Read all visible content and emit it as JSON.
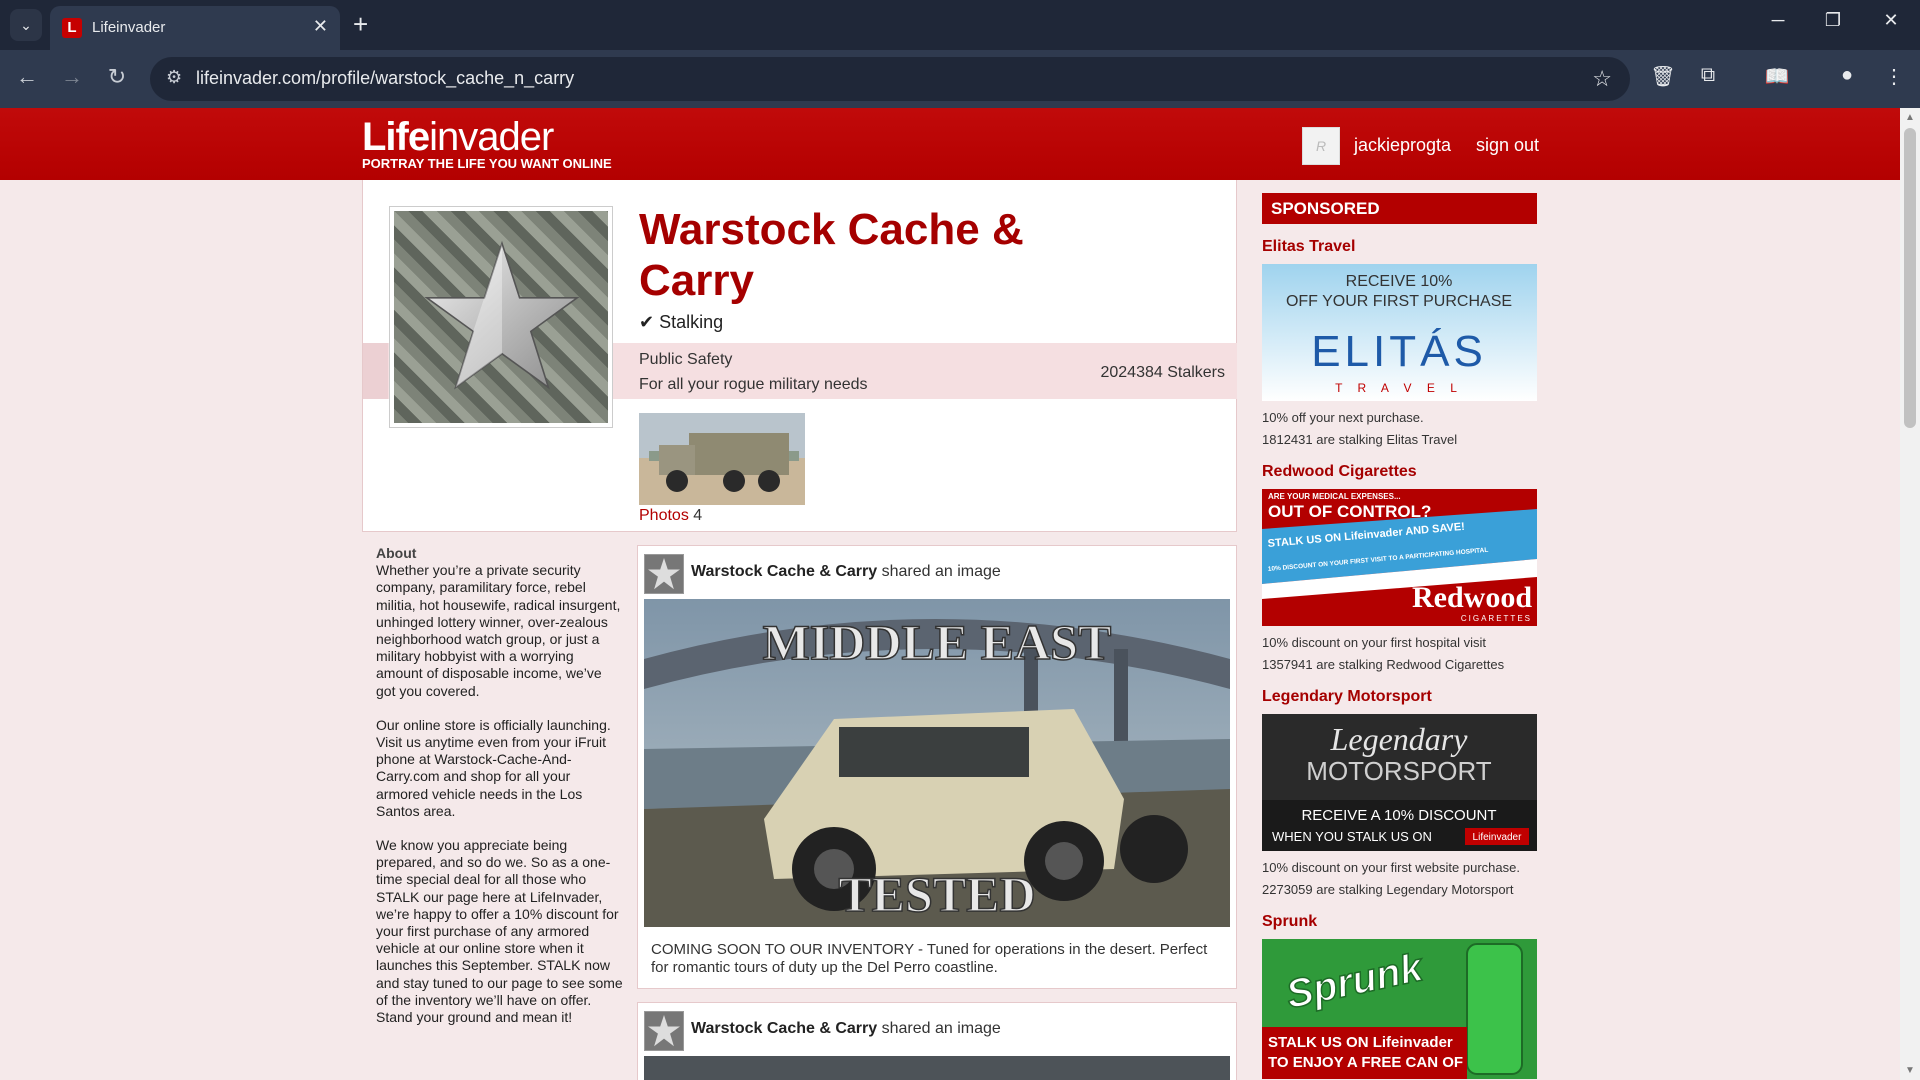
{
  "browser": {
    "tab_title": "Lifeinvader",
    "tab_favicon": "L",
    "url": "lifeinvader.com/profile/warstock_cache_n_carry"
  },
  "site": {
    "logo_bold": "Life",
    "logo_light": "invader",
    "logo_tagline": "PORTRAY THE LIFE YOU WANT ONLINE",
    "username": "jackieprogta",
    "signout": "sign out"
  },
  "profile": {
    "name": "Warstock Cache & Carry",
    "stalking_label": "Stalking",
    "category": "Public Safety",
    "tagline": "For all your rogue military needs",
    "stalkers": "2024384 Stalkers",
    "photos_label": "Photos",
    "photos_count": "4"
  },
  "about": {
    "title": "About",
    "p1": "Whether you’re a private security company, paramilitary force, rebel militia, hot housewife, radical insurgent, unhinged lottery winner, over-zealous neighborhood watch group, or just a military hobbyist with a worrying amount of disposable income, we’ve got you covered.",
    "p2": "Our online store is officially launching. Visit us anytime even from your iFruit phone at Warstock-Cache-And-Carry.com and shop for all your armored vehicle needs in the Los Santos area.",
    "p3": "We know you appreciate being prepared, and so do we. So as a one-time special deal for all those who STALK our page here at LifeInvader, we’re happy to offer a 10% discount for your first purchase of any armored vehicle at our online store when it launches this September. STALK now and stay tuned to our page to see some of the inventory we’ll have on offer.",
    "p4": "Stand your ground and mean it!"
  },
  "posts": [
    {
      "author": "Warstock Cache & Carry",
      "action": "shared an image",
      "image_top_text": "MIDDLE EAST",
      "image_bottom_text": "TESTED",
      "text": "COMING SOON TO OUR INVENTORY - Tuned for operations in the desert. Perfect for romantic tours of duty up the Del Perro coastline."
    },
    {
      "author": "Warstock Cache & Carry",
      "action": "shared an image"
    }
  ],
  "sponsored": {
    "header": "SPONSORED",
    "ads": [
      {
        "title": "Elitas Travel",
        "banner_line1": "RECEIVE 10%",
        "banner_line2": "OFF YOUR FIRST PURCHASE",
        "banner_brand": "ELITÁS",
        "banner_sub": "T R A V E L",
        "desc": "10% off your next purchase.",
        "stalkers": "1812431 are stalking Elitas Travel"
      },
      {
        "title": "Redwood Cigarettes",
        "banner_line1": "ARE YOUR MEDICAL EXPENSES...",
        "banner_line2": "OUT OF CONTROL?",
        "banner_line3": "STALK US ON Lifeinvader AND SAVE!",
        "banner_line4": "10% DISCOUNT ON YOUR FIRST VISIT TO A PARTICIPATING HOSPITAL",
        "banner_brand": "Redwood",
        "banner_sub": "CIGARETTES",
        "desc": "10% discount on your first hospital visit",
        "stalkers": "1357941 are stalking Redwood Cigarettes"
      },
      {
        "title": "Legendary Motorsport",
        "banner_brand": "Legendary",
        "banner_brand2": "MOTORSPORT",
        "banner_line1": "RECEIVE A 10% DISCOUNT",
        "banner_line2": "WHEN YOU STALK US ON",
        "banner_badge": "Lifeinvader",
        "desc": "10% discount on your first website purchase.",
        "stalkers": "2273059 are stalking Legendary Motorsport"
      },
      {
        "title": "Sprunk",
        "banner_brand": "Sprunk",
        "banner_line1": "STALK US ON Lifeinvader",
        "banner_line2": "TO ENJOY A FREE CAN OF"
      }
    ]
  }
}
